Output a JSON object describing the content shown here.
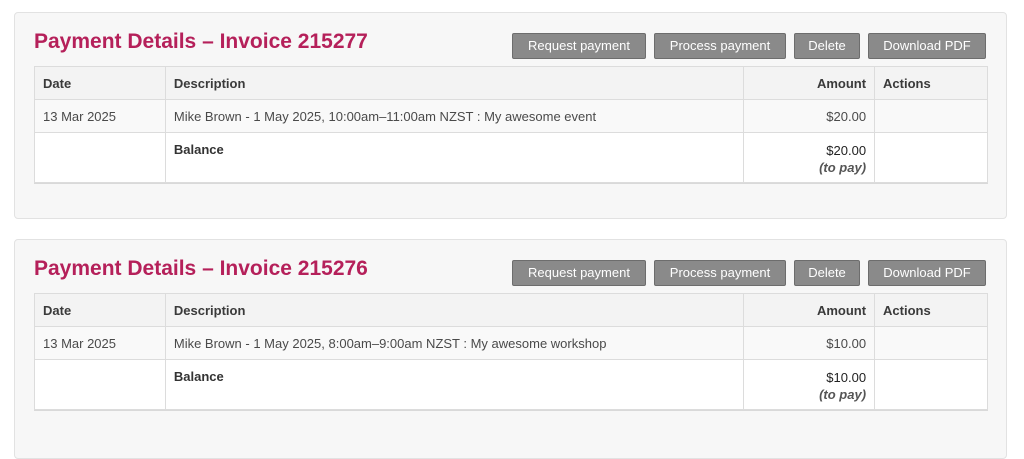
{
  "invoices": [
    {
      "title": "Payment Details – Invoice 215277",
      "buttons": {
        "request": "Request payment",
        "process": "Process payment",
        "delete": "Delete",
        "download": "Download PDF"
      },
      "columns": {
        "date": "Date",
        "description": "Description",
        "amount": "Amount",
        "actions": "Actions"
      },
      "items": [
        {
          "date": "13 Mar 2025",
          "description": "Mike Brown - 1 May 2025, 10:00am–11:00am NZST : My awesome event",
          "amount": "$20.00",
          "actions": ""
        }
      ],
      "balance": {
        "label": "Balance",
        "amount": "$20.00",
        "note": "(to pay)"
      }
    },
    {
      "title": "Payment Details – Invoice 215276",
      "buttons": {
        "request": "Request payment",
        "process": "Process payment",
        "delete": "Delete",
        "download": "Download PDF"
      },
      "columns": {
        "date": "Date",
        "description": "Description",
        "amount": "Amount",
        "actions": "Actions"
      },
      "items": [
        {
          "date": "13 Mar 2025",
          "description": "Mike Brown - 1 May 2025, 8:00am–9:00am NZST : My awesome workshop",
          "amount": "$10.00",
          "actions": ""
        }
      ],
      "balance": {
        "label": "Balance",
        "amount": "$10.00",
        "note": "(to pay)"
      }
    }
  ],
  "colors": {
    "title": "#b5205a",
    "button_bg": "#8a8a8a",
    "button_text": "#ffffff",
    "card_bg": "#f7f7f7"
  }
}
